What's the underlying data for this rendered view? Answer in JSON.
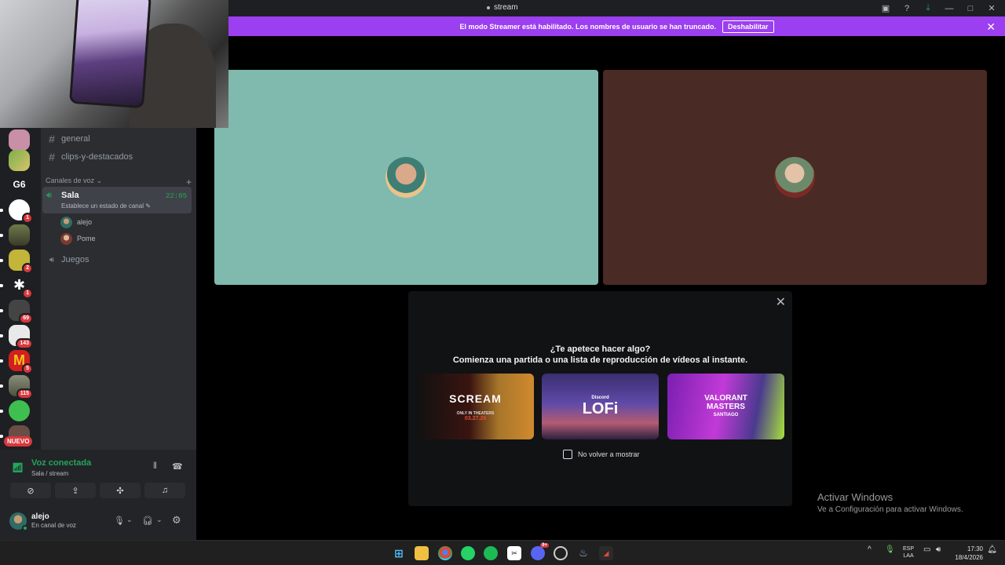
{
  "window": {
    "title": "stream"
  },
  "banner": {
    "text": "El modo Streamer está habilitado. Los nombres de usuario se han truncado.",
    "button": "Deshabilitar"
  },
  "sidebar": {
    "text_channels": [
      {
        "name": "general"
      },
      {
        "name": "clips-y-destacados"
      }
    ],
    "voice_category": "Canales de voz",
    "voice_channels": [
      {
        "name": "Sala",
        "time": "22:05",
        "status": "Establece un estado de canal"
      },
      {
        "name": "Juegos"
      }
    ],
    "voice_users": [
      {
        "name": "alejo"
      },
      {
        "name": "Pome"
      }
    ]
  },
  "servers": {
    "g6_label": "G6",
    "badges": [
      "1",
      "2",
      "1",
      "69",
      "143",
      "5",
      "115"
    ],
    "new_label": "NUEVO"
  },
  "voice_panel": {
    "title": "Voz conectada",
    "subtitle": "Sala / stream",
    "user_name": "alejo",
    "user_status": "En canal de voz"
  },
  "activity": {
    "heading": "¿Te apetece hacer algo?",
    "subheading": "Comienza una partida o una lista de reproducción de vídeos al instante.",
    "cards": [
      {
        "title": "SCREAM",
        "subtitle": "ONLY IN THEATERS",
        "date": "03.27.26"
      },
      {
        "title": "LOFi",
        "brand": "Discord"
      },
      {
        "title": "VALORANT",
        "line2": "MASTERS",
        "line3": "SANTIAGO"
      }
    ],
    "checkbox_label": "No volver a mostrar"
  },
  "watermark": {
    "title": "Activar Windows",
    "subtitle": "Ve a Configuración para activar Windows."
  },
  "taskbar": {
    "lang_top": "ESP",
    "lang_bottom": "LAA",
    "time": "17:30",
    "date": "18/4/2026",
    "discord_badge": "9+"
  },
  "colors": {
    "streamer_banner": "#9b3ff0",
    "tile_left": "#80b9ae",
    "tile_right": "#4a2a24",
    "voice_green": "#23a55a",
    "badge_red": "#da373c"
  }
}
